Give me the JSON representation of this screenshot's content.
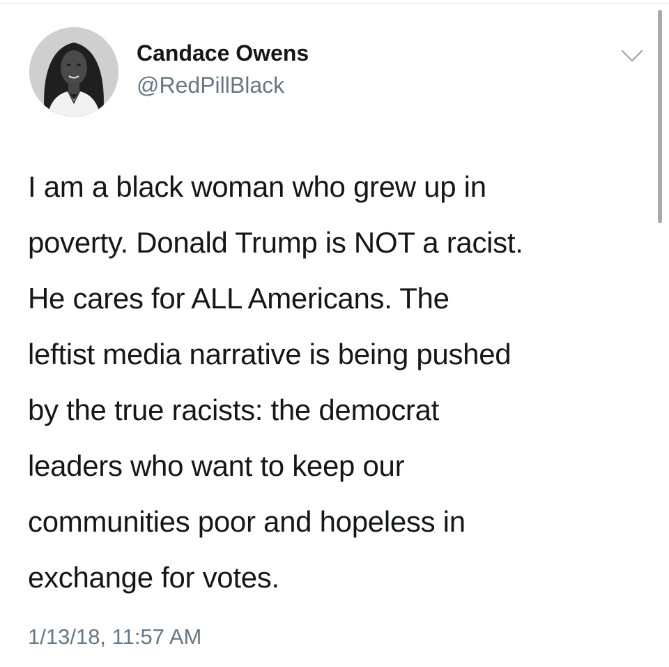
{
  "tweet": {
    "author": {
      "display_name": "Candace Owens",
      "handle": "@RedPillBlack",
      "avatar_icon": "user-avatar"
    },
    "menu_icon": "chevron-down-icon",
    "text_lines": [
      "I am a black woman who grew up in",
      "poverty. Donald Trump is NOT a racist.",
      "He cares for ALL Americans. The",
      "leftist media narrative is being pushed",
      "by the true racists: the democrat",
      "leaders who want to keep our",
      "communities poor and hopeless in",
      "exchange for votes."
    ],
    "timestamp": "1/13/18, 11:57 AM"
  },
  "colors": {
    "primary_text": "#14171a",
    "secondary_text": "#657786",
    "divider": "#e1e8ed",
    "scrollbar": "#a9a9a9"
  }
}
